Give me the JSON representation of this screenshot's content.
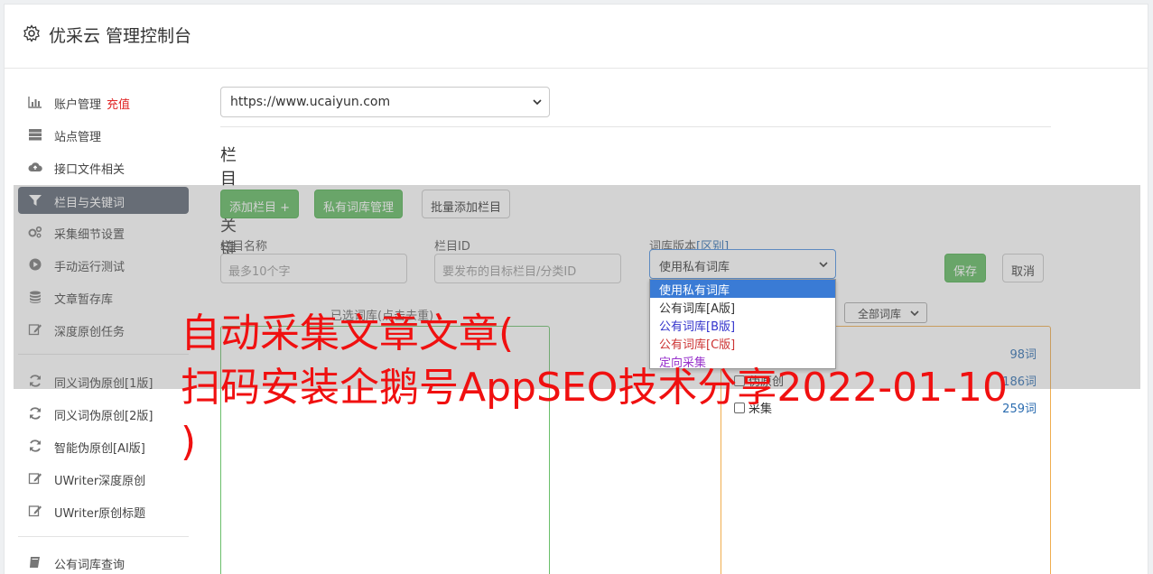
{
  "header": {
    "title": "优采云 管理控制台"
  },
  "sidebar": {
    "items": [
      {
        "label": "账户管理",
        "extra": "充值",
        "icon": "bar-chart-icon"
      },
      {
        "label": "站点管理",
        "icon": "server-icon"
      },
      {
        "label": "接口文件相关",
        "icon": "cloud-upload-icon"
      },
      {
        "label": "栏目与关键词",
        "icon": "filter-icon",
        "active": true
      },
      {
        "label": "采集细节设置",
        "icon": "cogs-icon"
      },
      {
        "label": "手动运行测试",
        "icon": "play-circle-icon"
      },
      {
        "label": "文章暂存库",
        "icon": "database-icon"
      },
      {
        "label": "深度原创任务",
        "icon": "edit-icon"
      },
      {
        "label": "同义词伪原创[1版]",
        "icon": "refresh-icon"
      },
      {
        "label": "同义词伪原创[2版]",
        "icon": "refresh-icon"
      },
      {
        "label": "智能伪原创[AI版]",
        "icon": "refresh-icon"
      },
      {
        "label": "UWriter深度原创",
        "icon": "edit-icon"
      },
      {
        "label": "UWriter原创标题",
        "icon": "edit-icon"
      },
      {
        "label": "公有词库查询",
        "icon": "book-icon"
      }
    ]
  },
  "site_select": {
    "value": "https://www.ucaiyun.com"
  },
  "section_title": "栏目与关键词",
  "toolbar": {
    "add_column": "添加栏目 +",
    "private_lib": "私有词库管理",
    "batch_add": "批量添加栏目"
  },
  "form": {
    "column_name_label": "栏目名称",
    "column_name_placeholder": "最多10个字",
    "column_id_label": "栏目ID",
    "column_id_placeholder": "要发布的目标栏目/分类ID",
    "version_label": "词库版本",
    "version_diff": "[区别]",
    "version_value": "使用私有词库",
    "save": "保存",
    "cancel": "取消"
  },
  "dropdown": {
    "options": [
      {
        "label": "使用私有词库",
        "color": "#ffffff",
        "selected": true
      },
      {
        "label": "公有词库[A版]",
        "color": "#333333"
      },
      {
        "label": "公有词库[B版]",
        "color": "#3333cc"
      },
      {
        "label": "公有词库[C版]",
        "color": "#cc3333"
      },
      {
        "label": "定向采集",
        "color": "#9933cc"
      }
    ]
  },
  "selected_lib_title": "已选词库(点击去重)",
  "all_lib_select": "全部词库",
  "lib_rows": [
    {
      "name": "",
      "count": "98词"
    },
    {
      "name": "伪原创",
      "count": "186词"
    },
    {
      "name": "采集",
      "count": "259词"
    }
  ],
  "headline": {
    "line1": "自动采集文章文章(",
    "line2": "扫码安装企鹅号AppSEO技术分享2022-01-10",
    "line3": ")"
  }
}
